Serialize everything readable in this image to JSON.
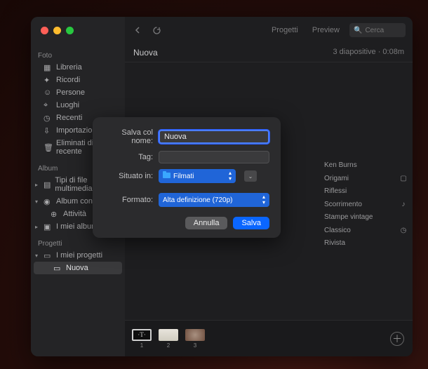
{
  "sidebar": {
    "sections": {
      "foto": {
        "title": "Foto",
        "items": [
          {
            "label": "Libreria"
          },
          {
            "label": "Ricordi"
          },
          {
            "label": "Persone"
          },
          {
            "label": "Luoghi"
          },
          {
            "label": "Recenti"
          },
          {
            "label": "Importazioni"
          },
          {
            "label": "Eliminati di recente"
          }
        ]
      },
      "album": {
        "title": "Album",
        "items": [
          {
            "label": "Tipi di file multimediali"
          },
          {
            "label": "Album condivisi"
          },
          {
            "label": "Attività"
          },
          {
            "label": "I miei album"
          }
        ]
      },
      "progetti": {
        "title": "Progetti",
        "items": [
          {
            "label": "I miei progetti"
          },
          {
            "label": "Nuova"
          }
        ]
      }
    }
  },
  "toolbar": {
    "tabs": {
      "progetti": "Progetti",
      "preview": "Preview"
    },
    "search_placeholder": "Cerca"
  },
  "header": {
    "title": "Nuova",
    "meta": "3 diapositive · 0:08m"
  },
  "themes": {
    "items": [
      {
        "label": "Ken Burns"
      },
      {
        "label": "Origami"
      },
      {
        "label": "Riflessi"
      },
      {
        "label": "Scorrimento"
      },
      {
        "label": "Stampe vintage"
      },
      {
        "label": "Classico"
      },
      {
        "label": "Rivista"
      }
    ]
  },
  "filmstrip": {
    "thumbs": [
      {
        "n": "1"
      },
      {
        "n": "2"
      },
      {
        "n": "3"
      }
    ]
  },
  "sheet": {
    "name_label": "Salva col nome:",
    "name_value": "Nuova",
    "tag_label": "Tag:",
    "tag_value": "",
    "location_label": "Situato in:",
    "location_value": "Filmati",
    "format_label": "Formato:",
    "format_value": "Alta definizione (720p)",
    "cancel": "Annulla",
    "save": "Salva"
  }
}
